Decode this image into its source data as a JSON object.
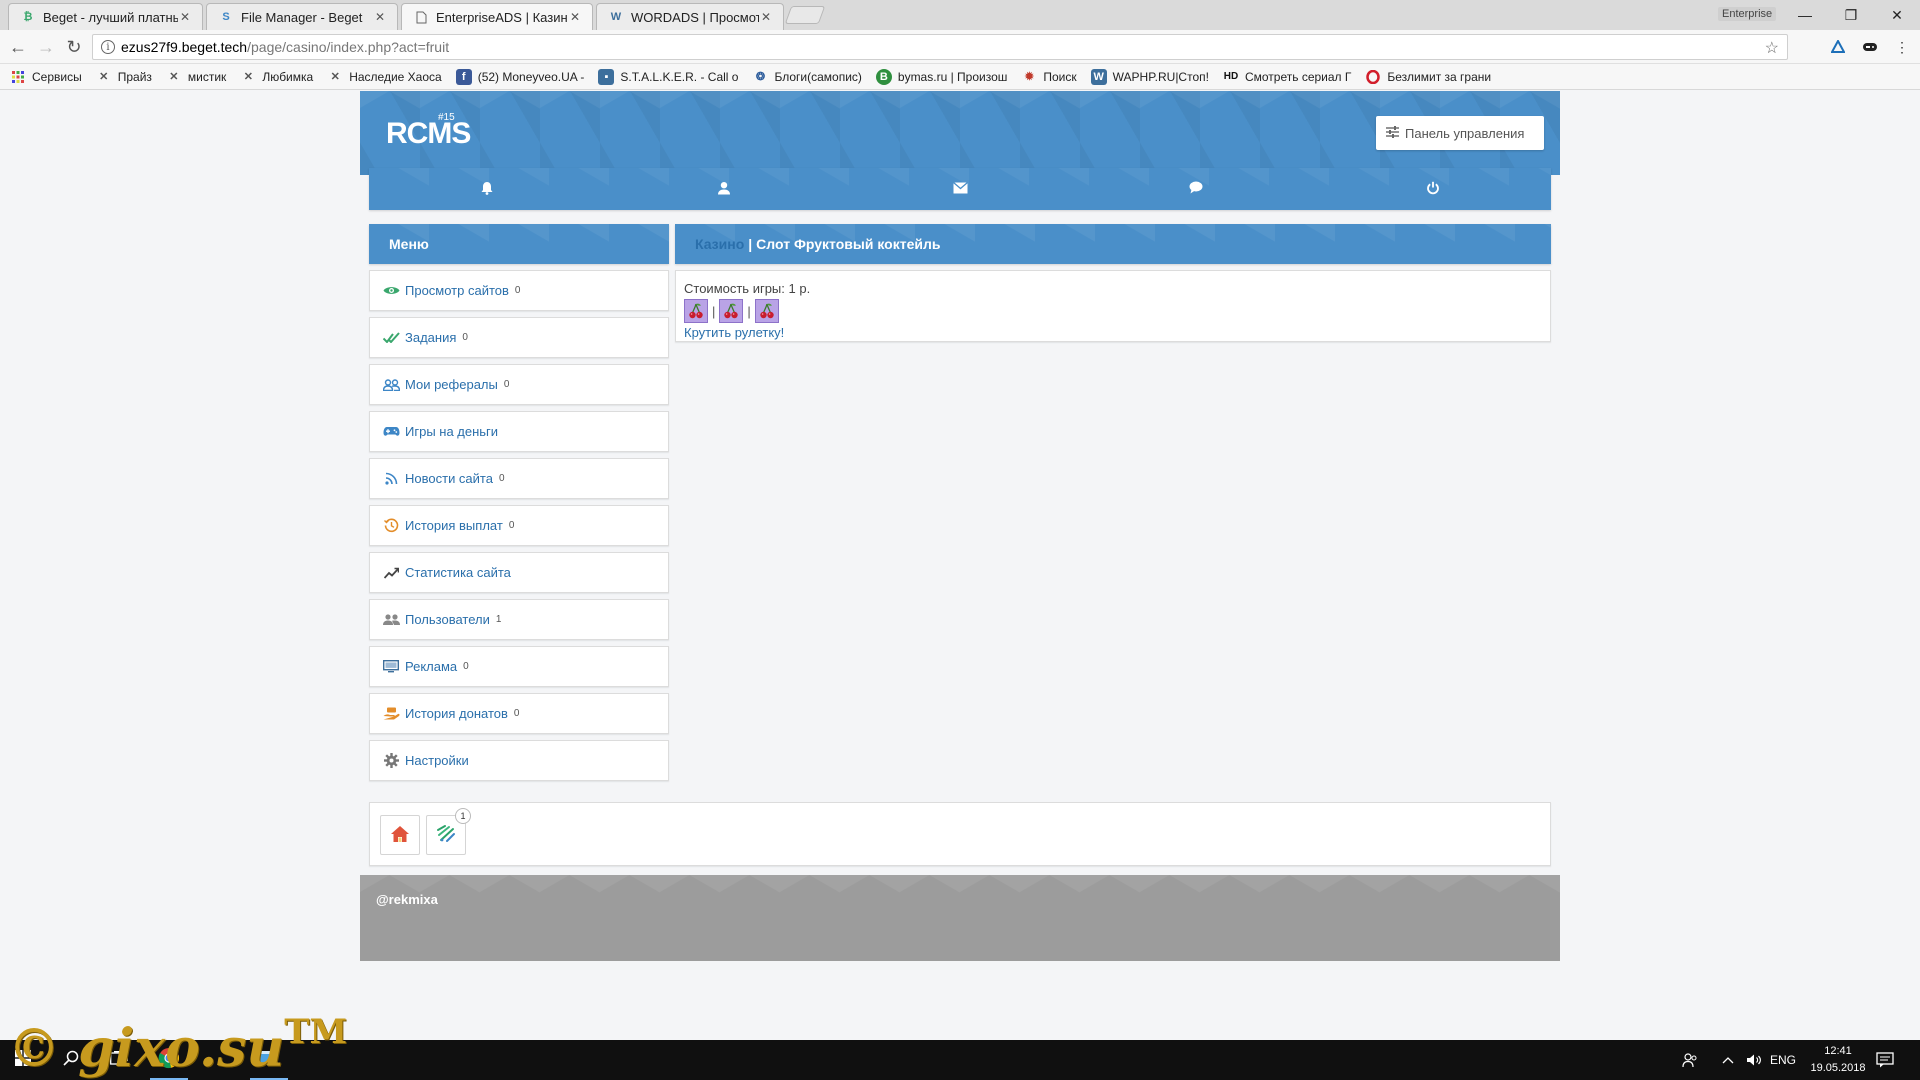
{
  "browser": {
    "tabs": [
      {
        "title": "Beget - лучший платный",
        "favicon": "beget-icon",
        "active": false
      },
      {
        "title": "File Manager - Beget",
        "favicon": "beget-s-icon",
        "active": false
      },
      {
        "title": "EnterpriseADS | Казино",
        "favicon": "page-icon",
        "active": true
      },
      {
        "title": "WORDADS | Просмотр т",
        "favicon": "w-icon",
        "active": false
      }
    ],
    "profile_label": "Enterprise",
    "url_host": "ezus27f9.beget.tech",
    "url_path": "/page/casino/index.php?act=fruit",
    "bookmarks": [
      {
        "label": "Сервисы",
        "icon": "apps-icon"
      },
      {
        "label": "Прайз",
        "icon": "stalker-icon"
      },
      {
        "label": "мистик",
        "icon": "stalker-icon"
      },
      {
        "label": "Любимка",
        "icon": "stalker-icon"
      },
      {
        "label": "Наследие Хаоса",
        "icon": "stalker-icon"
      },
      {
        "label": "(52) Moneyveo.UA -",
        "icon": "facebook-icon"
      },
      {
        "label": "S.T.A.L.K.E.R. - Call o",
        "icon": "chat-icon"
      },
      {
        "label": "Блоги(самопис)",
        "icon": "blog-icon"
      },
      {
        "label": "bymas.ru | Произош",
        "icon": "b-icon"
      },
      {
        "label": "Поиск",
        "icon": "search-site-icon"
      },
      {
        "label": "WAPHP.RU|Стоп!",
        "icon": "w-icon"
      },
      {
        "label": "Смотреть сериал Г",
        "icon": "hd-icon"
      },
      {
        "label": "Безлимит за грани",
        "icon": "opera-icon"
      }
    ]
  },
  "site": {
    "logo": "RCMS",
    "logo_version": "#15",
    "control_panel_label": "Панель управления",
    "nav_icons": [
      "bell-icon",
      "user-icon",
      "envelope-icon",
      "comment-icon",
      "power-icon"
    ],
    "menu_title": "Меню",
    "menu": [
      {
        "label": "Просмотр сайтов",
        "count": "0",
        "icon": "eye-icon",
        "color": "#3aa76d"
      },
      {
        "label": "Задания",
        "count": "0",
        "icon": "check-icon",
        "color": "#3aa76d"
      },
      {
        "label": "Мои рефералы",
        "count": "0",
        "icon": "users-icon",
        "color": "#3d86c6"
      },
      {
        "label": "Игры на деньги",
        "count": "",
        "icon": "gamepad-icon",
        "color": "#3d86c6"
      },
      {
        "label": "Новости сайта",
        "count": "0",
        "icon": "rss-icon",
        "color": "#3d86c6"
      },
      {
        "label": "История выплат",
        "count": "0",
        "icon": "history-icon",
        "color": "#e38d2a"
      },
      {
        "label": "Статистика сайта",
        "count": "",
        "icon": "chart-icon",
        "color": "#555555"
      },
      {
        "label": "Пользователи",
        "count": "1",
        "icon": "people-icon",
        "color": "#777777"
      },
      {
        "label": "Реклама",
        "count": "0",
        "icon": "monitor-icon",
        "color": "#3d6f9c"
      },
      {
        "label": "История донатов",
        "count": "0",
        "icon": "donate-icon",
        "color": "#e38d2a"
      },
      {
        "label": "Настройки",
        "count": "",
        "icon": "gear-icon",
        "color": "#777777"
      }
    ],
    "breadcrumb_link": "Казино",
    "breadcrumb_sep": "|",
    "page_title": "Слот Фруктовый коктейль",
    "game_cost_label": "Стоимость игры: 1 р.",
    "reels": [
      "cherry-icon",
      "cherry-icon",
      "cherry-icon"
    ],
    "reel_separator": "|",
    "spin_label": "Крутить рулетку!",
    "quickbar": [
      {
        "icon": "home-icon",
        "badge": ""
      },
      {
        "icon": "online-icon",
        "badge": "1"
      }
    ],
    "footer_credit": "@rekmixa"
  },
  "watermark": {
    "text": "© gixo.su",
    "tm": "TM"
  },
  "taskbar": {
    "lang": "ENG",
    "time": "12:41",
    "date": "19.05.2018"
  },
  "colors": {
    "brand": "#4a8fc9",
    "link": "#2a6fab",
    "footer": "#9c9c9c"
  }
}
